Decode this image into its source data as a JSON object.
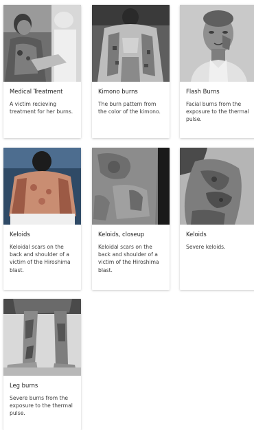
{
  "gallery": {
    "cards": [
      {
        "image": "photo-medical-treatment",
        "title": "Medical Treatment",
        "description": "A victim recieving treatment for her burns."
      },
      {
        "image": "photo-kimono-burns",
        "title": "Kimono burns",
        "description": "The burn pattern from the color of the kimono."
      },
      {
        "image": "photo-flash-burns",
        "title": "Flash Burns",
        "description": "Facial burns from the exposure to the thermal pulse."
      },
      {
        "image": "photo-keloids-back",
        "title": "Keloids",
        "description": "Keloidal scars on the back and shoulder of a victim of the Hiroshima blast."
      },
      {
        "image": "photo-keloids-closeup",
        "title": "Keloids, closeup",
        "description": "Keloidal scars on the back and shoulder of a victim of the Hiroshima blast."
      },
      {
        "image": "photo-keloids-neck",
        "title": "Keloids",
        "description": "Severe keloids."
      },
      {
        "image": "photo-leg-burns",
        "title": "Leg burns",
        "description": "Severe burns from the exposure to the thermal pulse."
      }
    ]
  },
  "colors": {
    "card_background": "#ffffff",
    "text": "#222222",
    "page_background": "#ffffff"
  }
}
